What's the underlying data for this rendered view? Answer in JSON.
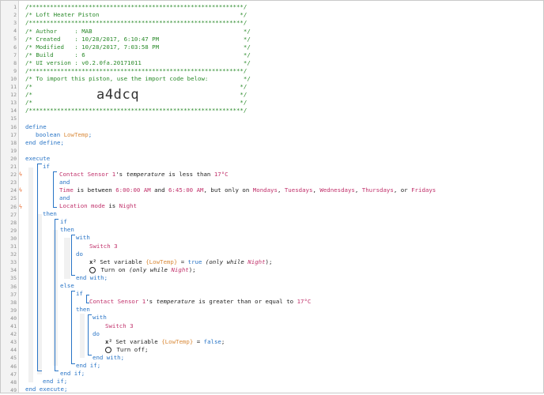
{
  "gutter": {
    "line_numbers": [
      "1",
      "2",
      "3",
      "4",
      "5",
      "6",
      "7",
      "8",
      "9",
      "10",
      "11",
      "12",
      "13",
      "14",
      "15",
      "16",
      "17",
      "18",
      "19",
      "20",
      "21",
      "22",
      "23",
      "24",
      "25",
      "26",
      "27",
      "28",
      "29",
      "30",
      "31",
      "32",
      "33",
      "34",
      "35",
      "36",
      "37",
      "38",
      "39",
      "40",
      "41",
      "42",
      "43",
      "44",
      "45",
      "46",
      "47",
      "48",
      "49"
    ],
    "error_marker": "ϟ"
  },
  "header": {
    "border": "/*************************************************************/",
    "title_line": "/* Loft Heater Piston                                        */",
    "author_line": "/* Author     : MAB                                           */",
    "created_line": "/* Created    : 10/28/2017, 6:10:47 PM                        */",
    "modified_line": "/* Modified   : 10/28/2017, 7:03:58 PM                        */",
    "build_line": "/* Build      : 6                                             */",
    "ui_line": "/* UI version : v0.2.0fa.20171011                             */",
    "import_line": "/* To import this piston, use the import code below:          */",
    "blank_line": "/*                                                           */",
    "import_code": "a4dcq"
  },
  "code": {
    "define": "define",
    "var_type": "boolean",
    "var_name": "LowTemp",
    "semicolon": ";",
    "end_define": "end define;",
    "execute": "execute",
    "if": "if",
    "contact_sensor": "Contact Sensor 1",
    "possessive": "'s",
    "temperature": "temperature",
    "is_less_than": "is less than",
    "temp_value": "17°C",
    "and": "and",
    "time": "Time",
    "is_between": "is between",
    "time_start": "6:00:00 AM",
    "time_and": "and",
    "time_end": "6:45:00 AM",
    "but_only_on": ", but only on",
    "day1": "Mondays",
    "day2": "Tuesdays",
    "day3": "Wednesdays",
    "day4": "Thursdays",
    "or": "or",
    "day5": "Fridays",
    "location_mode": "Location mode",
    "is": "is",
    "mode_value": "Night",
    "then": "then",
    "with": "with",
    "switch": "Switch 3",
    "do": "do",
    "set_variable": "Set variable",
    "lowtemp_braced": "{LowTemp}",
    "equals": "=",
    "true": "true",
    "false": "false",
    "only_while": "(only while",
    "night": "Night",
    "close_paren_semi": ");",
    "turn_on": "Turn on",
    "turn_off": "Turn off;",
    "end_with": "end with;",
    "else": "else",
    "is_ge": "is greater than or equal to",
    "end_if": "end if;",
    "end_execute": "end execute;"
  }
}
